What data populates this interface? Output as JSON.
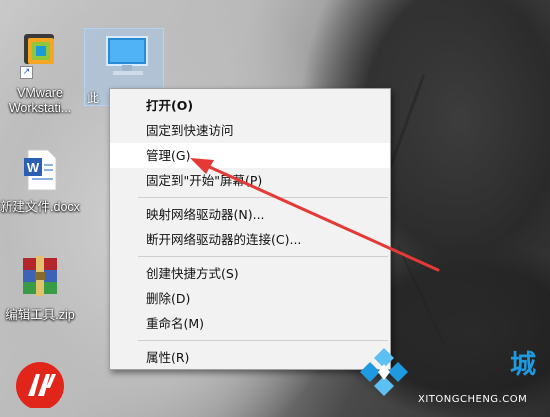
{
  "desktop": {
    "icons": [
      {
        "label": "VMware Workstati..."
      },
      {
        "label": "新建文件.docx"
      },
      {
        "label": "编辑工具.zip"
      }
    ],
    "computer_label_partial": "此"
  },
  "context_menu": {
    "items": [
      {
        "label": "打开(O)",
        "bold": true
      },
      {
        "label": "固定到快速访问"
      },
      {
        "label": "管理(G)",
        "highlighted": true
      },
      {
        "label": "固定到\"开始\"屏幕(P)"
      },
      {
        "label": "映射网络驱动器(N)..."
      },
      {
        "label": "断开网络驱动器的连接(C)..."
      },
      {
        "label": "创建快捷方式(S)"
      },
      {
        "label": "删除(D)"
      },
      {
        "label": "重命名(M)"
      },
      {
        "label": "属性(R)"
      }
    ]
  },
  "watermark": {
    "text": "XITONGCHENG.COM",
    "char": "城"
  },
  "colors": {
    "arrow": "#e53935",
    "menu_bg": "#f2f2f2",
    "highlight": "#ffffff",
    "watermark_blue": "#1e9be0"
  }
}
